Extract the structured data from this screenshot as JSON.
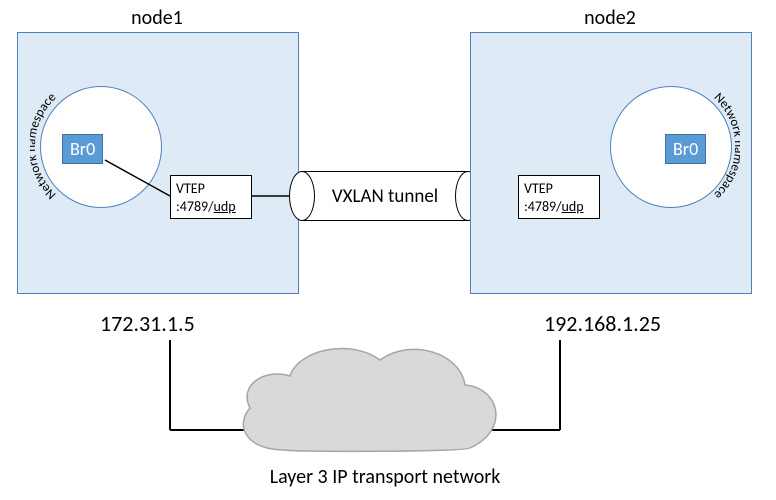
{
  "nodes": {
    "left": {
      "title": "node1",
      "namespace_label": "Network namespace",
      "bridge": "Br0",
      "vtep_line1": "VTEP",
      "vtep_port": ":4789/",
      "vtep_proto": "udp",
      "ip": "172.31.1.5"
    },
    "right": {
      "title": "node2",
      "namespace_label": "Network namespace",
      "bridge": "Br0",
      "vtep_line1": "VTEP",
      "vtep_port": ":4789/",
      "vtep_proto": "udp",
      "ip": "192.168.1.25"
    }
  },
  "tunnel_label": "VXLAN tunnel",
  "transport_label": "Layer 3 IP transport network",
  "colors": {
    "node_fill": "#deebf7",
    "node_border": "#4f81bd",
    "bridge_fill": "#5b9bd5",
    "bridge_border": "#41719c",
    "cloud_fill": "#d9d9d9",
    "cloud_stroke": "#a6a6a6"
  }
}
